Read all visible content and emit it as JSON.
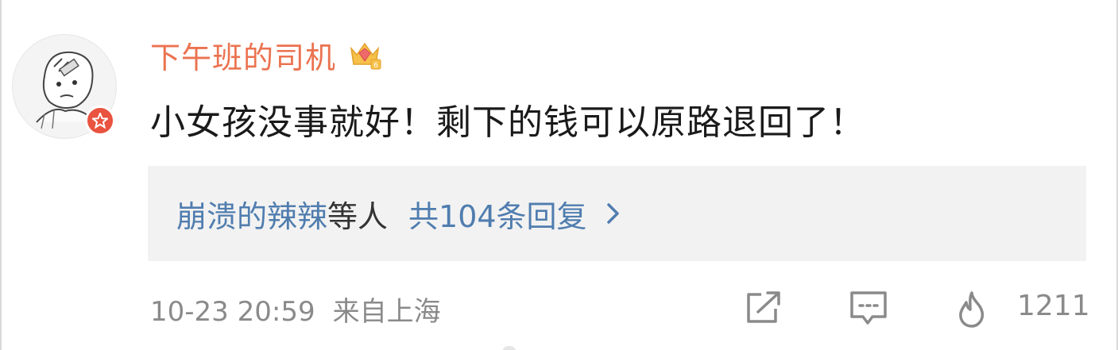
{
  "comment": {
    "username": "下午班的司机",
    "text": "小女孩没事就好！剩下的钱可以原路退回了！",
    "replies": {
      "names": "崩溃的辣辣",
      "etc": "等人",
      "count_text": "共104条回复"
    },
    "timestamp": "10-23 20:59",
    "location": "来自上海",
    "like_count": "1211"
  },
  "colors": {
    "username": "#eb7350",
    "link": "#507daf",
    "meta": "#8a8a8a",
    "reply_bg": "#f2f2f2",
    "badge": "#e9533f"
  },
  "icons": {
    "vip": "crown-gem-icon",
    "share": "share-icon",
    "reply": "comment-icon",
    "like": "flame-like-icon",
    "chevron": "chevron-right-icon",
    "verified": "verified-star-icon"
  }
}
